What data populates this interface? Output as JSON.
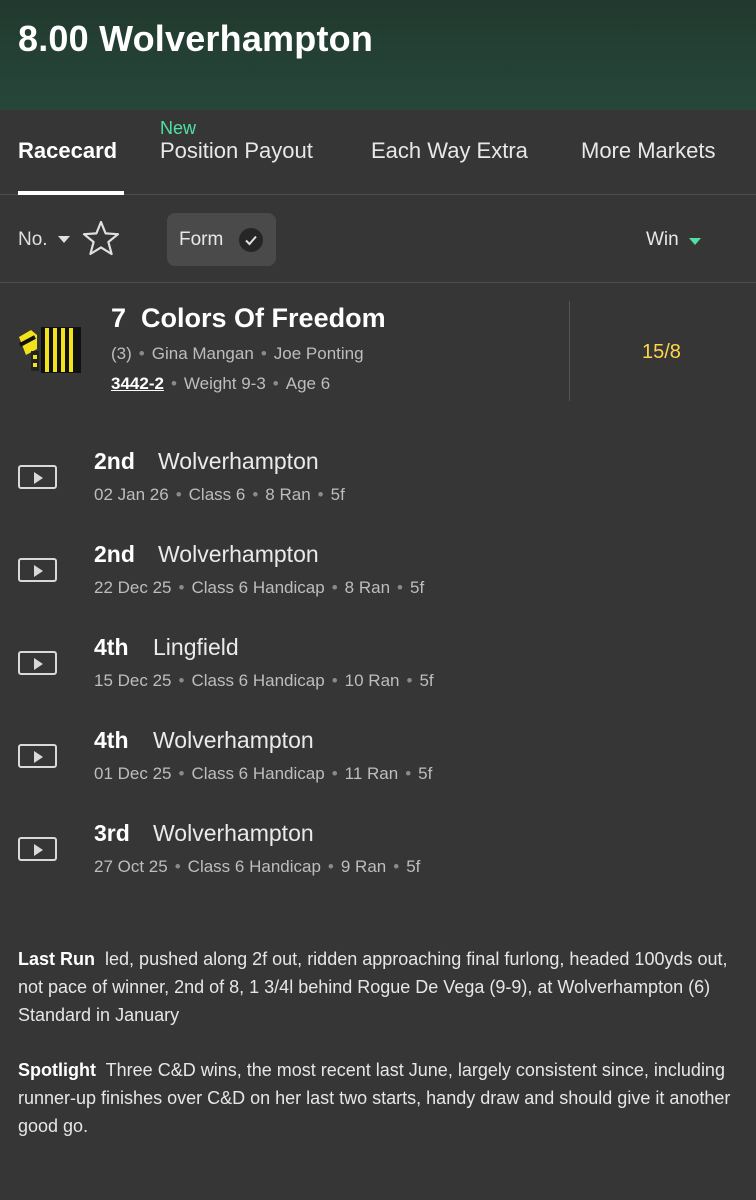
{
  "header": {
    "title": "8.00 Wolverhampton"
  },
  "tabs": {
    "new_badge": "New",
    "items": [
      {
        "label": "Racecard",
        "active": true
      },
      {
        "label": "Position Payout"
      },
      {
        "label": "Each Way Extra"
      },
      {
        "label": "More Markets"
      }
    ]
  },
  "filters": {
    "sort_label": "No.",
    "form_label": "Form",
    "win_label": "Win"
  },
  "runner": {
    "number": "7",
    "name": "Colors Of Freedom",
    "draw": "(3)",
    "jockey": "Gina Mangan",
    "trainer": "Joe Ponting",
    "form": "3442-2",
    "weight": "Weight 9-3",
    "age": "Age 6",
    "odds": "15/8"
  },
  "runs": [
    {
      "position": "2nd",
      "course": "Wolverhampton",
      "date": "02 Jan 26",
      "class": "Class 6",
      "ran": "8 Ran",
      "distance": "5f"
    },
    {
      "position": "2nd",
      "course": "Wolverhampton",
      "date": "22 Dec 25",
      "class": "Class 6 Handicap",
      "ran": "8 Ran",
      "distance": "5f"
    },
    {
      "position": "4th",
      "course": "Lingfield",
      "date": "15 Dec 25",
      "class": "Class 6 Handicap",
      "ran": "10 Ran",
      "distance": "5f"
    },
    {
      "position": "4th",
      "course": "Wolverhampton",
      "date": "01 Dec 25",
      "class": "Class 6 Handicap",
      "ran": "11 Ran",
      "distance": "5f"
    },
    {
      "position": "3rd",
      "course": "Wolverhampton",
      "date": "27 Oct 25",
      "class": "Class 6 Handicap",
      "ran": "9 Ran",
      "distance": "5f"
    }
  ],
  "last_run": {
    "label": "Last Run",
    "text": "led, pushed along 2f out, ridden approaching final furlong, headed 100yds out, not pace of winner, 2nd of 8, 1 3/4l behind Rogue De Vega (9-9), at Wolverhampton (6) Standard in January"
  },
  "spotlight": {
    "label": "Spotlight",
    "text": "Three C&D wins, the most recent last June, largely consistent since, including runner-up finishes over C&D on her last two starts, handy draw and should give it another good go."
  },
  "colors": {
    "header_bg": "#27473a",
    "accent_green": "#4fe0a4",
    "odds_yellow": "#ffd54a",
    "silk_yellow": "#f2e21c"
  }
}
